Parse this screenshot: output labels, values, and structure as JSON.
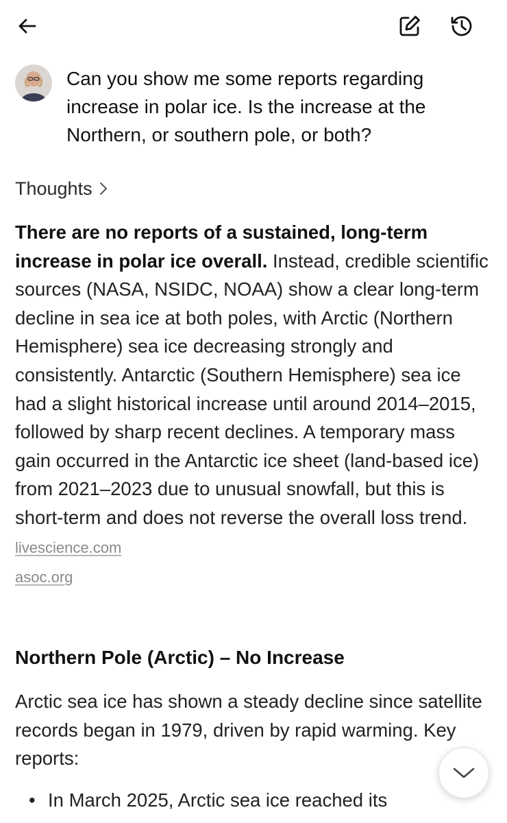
{
  "header": {
    "back_icon": "arrow-left-icon",
    "edit_icon": "edit-square-icon",
    "history_icon": "history-clock-icon"
  },
  "user_message": {
    "text": "Can you show me some reports regarding increase in polar ice.  Is the increase at the Northern, or southern pole, or both?"
  },
  "thoughts": {
    "label": "Thoughts"
  },
  "answer": {
    "lead_bold": "There are no reports of a sustained, long-term increase in polar ice overall.",
    "lead_rest": " Instead, credible scientific sources (NASA, NSIDC, NOAA) show a clear long-term decline in sea ice at both poles, with Arctic (Northern Hemisphere) sea ice decreasing strongly and consistently. Antarctic (Southern Hemisphere) sea ice had a slight historical increase until around 2014–2015, followed by sharp recent declines. A temporary mass gain occurred in the Antarctic ice sheet (land-based ice) from 2021–2023 due to unusual snowfall, but this is short-term and does not reverse the overall loss trend. ",
    "source_1": "livescience.com",
    "source_2": "asoc.org"
  },
  "section_north": {
    "heading": "Northern Pole (Arctic) – No Increase",
    "body": "Arctic sea ice has shown a steady decline since satellite records began in 1979, driven by rapid warming. Key reports:",
    "bullet_1": "In March 2025, Arctic sea ice reached its"
  },
  "scroll_button": {
    "icon": "chevron-down-icon"
  }
}
